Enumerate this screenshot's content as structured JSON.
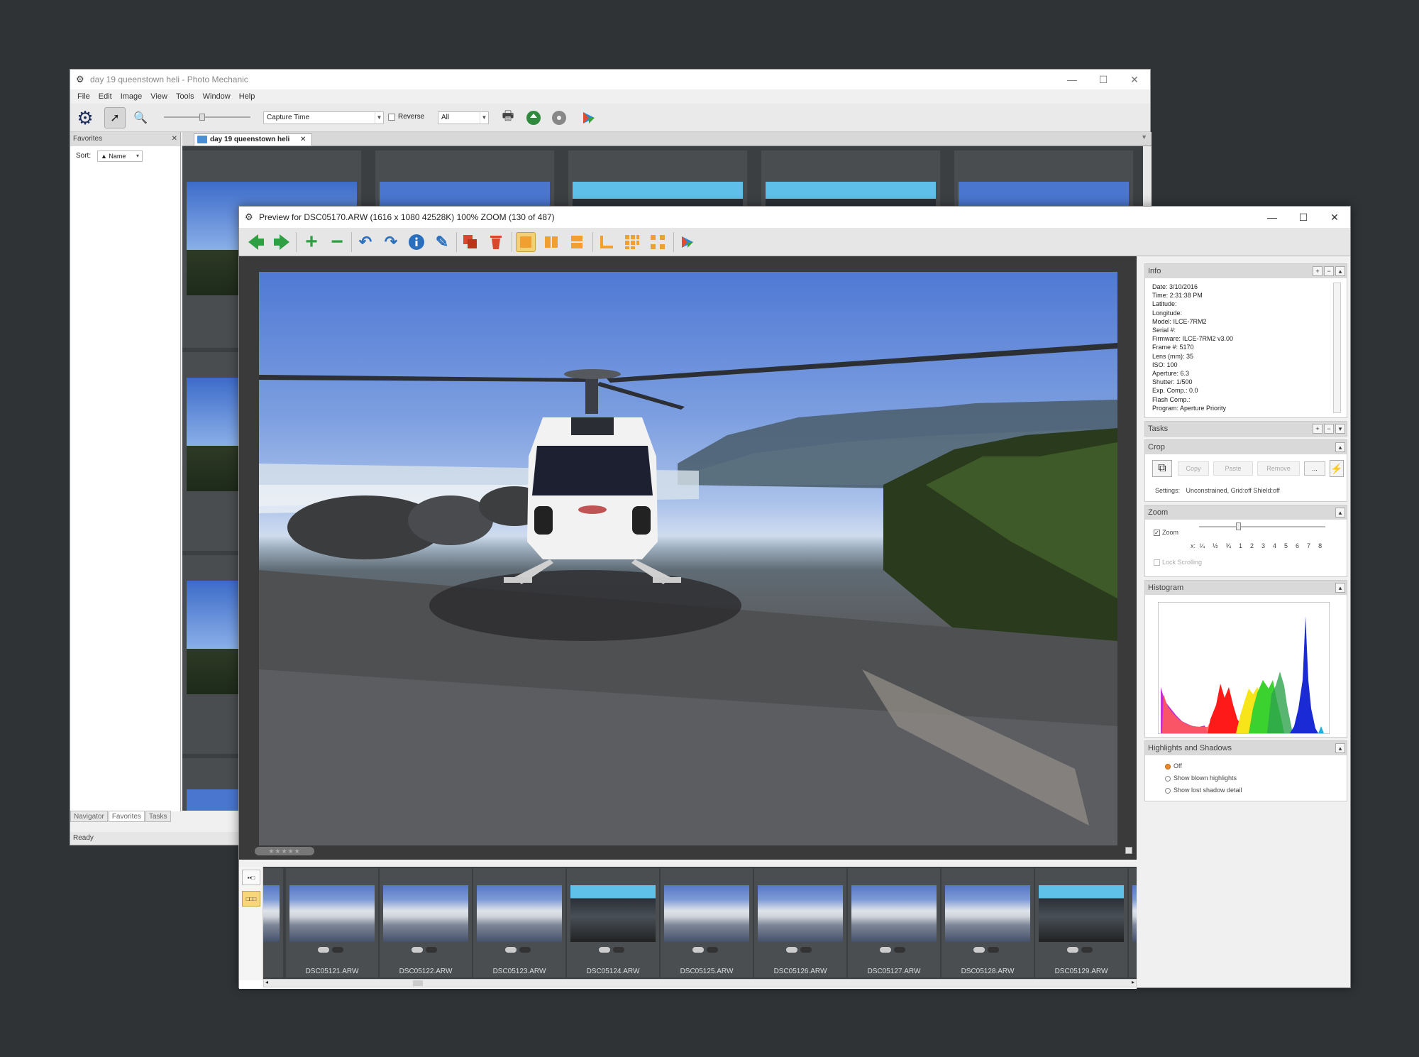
{
  "main": {
    "title": "day 19 queenstown heli - Photo Mechanic",
    "menu": [
      "File",
      "Edit",
      "Image",
      "View",
      "Tools",
      "Window",
      "Help"
    ],
    "sort_combo": "Capture Time",
    "reverse_label": "Reverse",
    "filter_combo": "All",
    "left_panel_title": "Favorites",
    "sort_label": "Sort:",
    "sort_value": "▲ Name",
    "bottom_tabs": [
      "Navigator",
      "Favorites",
      "Tasks"
    ],
    "status": "Ready",
    "contact_tab": "day 19 queenstown heli"
  },
  "preview": {
    "title": "Preview for DSC05170.ARW (1616 x 1080 42528K) 100% ZOOM (130 of 487)",
    "rating": "★★★★★",
    "filmstrip": [
      {
        "label": "DSC05121.ARW",
        "kind": "mountain"
      },
      {
        "label": "DSC05122.ARW",
        "kind": "mountain"
      },
      {
        "label": "DSC05123.ARW",
        "kind": "mountain"
      },
      {
        "label": "DSC05124.ARW",
        "kind": "cabin"
      },
      {
        "label": "DSC05125.ARW",
        "kind": "mountain"
      },
      {
        "label": "DSC05126.ARW",
        "kind": "mountain"
      },
      {
        "label": "DSC05127.ARW",
        "kind": "mountain"
      },
      {
        "label": "DSC05128.ARW",
        "kind": "mountain"
      },
      {
        "label": "DSC05129.ARW",
        "kind": "cabin"
      }
    ]
  },
  "panels": {
    "info": {
      "title": "Info",
      "lines": "Date: 3/10/2016\nTime: 2:31:38 PM\nLatitude:\nLongitude:\nModel: ILCE-7RM2\nSerial #:\nFirmware: ILCE-7RM2 v3.00\nFrame #: 5170\nLens (mm): 35\nISO: 100\nAperture: 6.3\nShutter: 1/500\nExp. Comp.: 0.0\nFlash Comp.:\nProgram: Aperture Priority"
    },
    "tasks": {
      "title": "Tasks"
    },
    "crop": {
      "title": "Crop",
      "copy": "Copy",
      "paste": "Paste",
      "remove": "Remove",
      "more": "...",
      "settings_label": "Settings:",
      "settings_value": "Unconstrained, Grid:off Shield:off"
    },
    "zoom": {
      "title": "Zoom",
      "zoom_label": "Zoom",
      "scale": "x: ¼  ½  ¾  1  2  3  4  5  6  7  8",
      "lock_label": "Lock Scrolling"
    },
    "histogram": {
      "title": "Histogram"
    },
    "highlights": {
      "title": "Highlights and Shadows",
      "options": [
        "Off",
        "Show blown highlights",
        "Show lost shadow detail"
      ]
    }
  },
  "colors": {
    "accent_orange": "#f0a030",
    "nav_green": "#2ea043",
    "nav_blue": "#2a6fbd"
  }
}
